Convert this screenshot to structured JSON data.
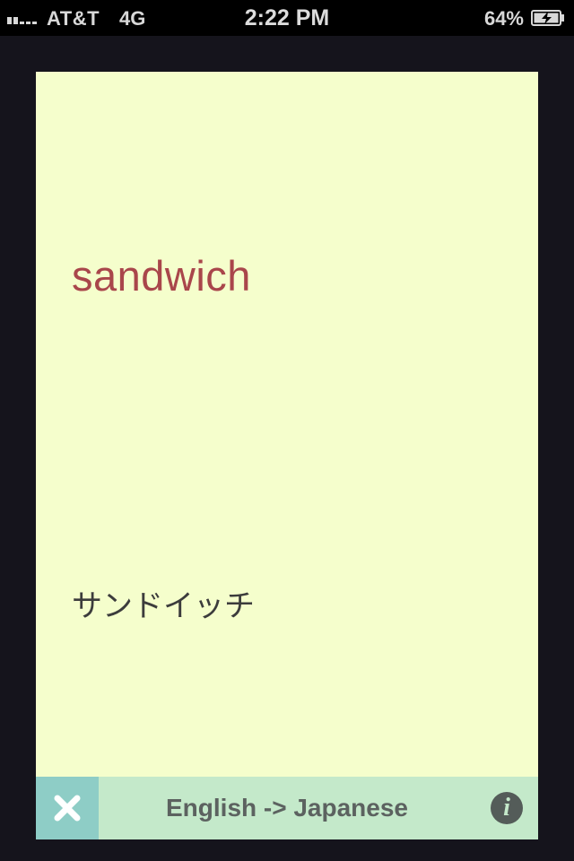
{
  "status_bar": {
    "carrier": "AT&T",
    "network": "4G",
    "time": "2:22 PM",
    "battery_percent": "64%",
    "signal_bars_filled": 1,
    "signal_bars_total": 5,
    "battery_level": 0.64,
    "icons": [
      "signal-icon",
      "battery-charging-icon"
    ]
  },
  "card": {
    "english_word": "sandwich",
    "japanese_word": "サンドイッチ"
  },
  "bottom_bar": {
    "direction_label": "English -> Japanese",
    "info_glyph": "i",
    "icons": [
      "close-icon",
      "info-icon"
    ]
  },
  "colors": {
    "card_background": "#f5fecc",
    "english_text": "#a9464b",
    "bottom_bar": "#c4e9ca",
    "close_button": "#8ecdc6"
  }
}
